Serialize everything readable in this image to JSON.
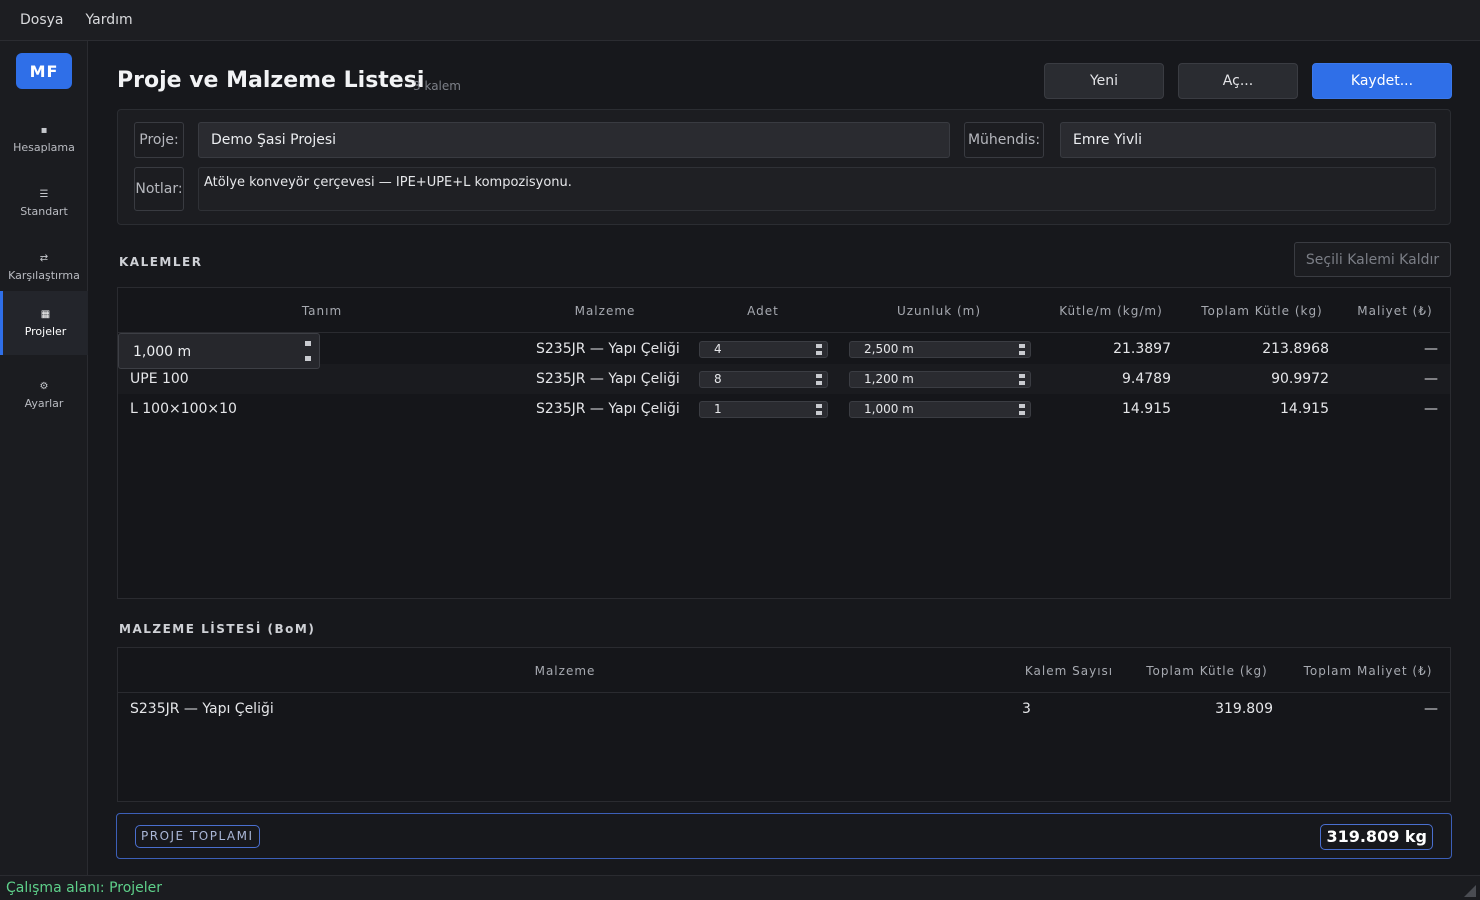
{
  "menu": {
    "file": "Dosya",
    "help": "Yardım"
  },
  "sidebar": {
    "logo": "MF",
    "items": [
      {
        "label": "Hesaplama",
        "icon": "▪"
      },
      {
        "label": "Standart",
        "icon": "☰"
      },
      {
        "label": "Karşılaştırma",
        "icon": "⇄"
      },
      {
        "label": "Projeler",
        "icon": "▦",
        "active": true
      },
      {
        "label": "Ayarlar",
        "icon": "⚙"
      }
    ]
  },
  "header": {
    "title": "Proje ve Malzeme Listesi",
    "count": "3 kalem",
    "new": "Yeni",
    "open": "Aç...",
    "save": "Kaydet..."
  },
  "form": {
    "project_label": "Proje:",
    "project_value": "Demo Şasi Projesi",
    "engineer_label": "Mühendis:",
    "engineer_value": "Emre Yivli",
    "notes_label": "Notlar:",
    "notes_value": "Atölye konveyör çerçevesi — IPE+UPE+L kompozisyonu."
  },
  "items": {
    "section": "KALEMLER",
    "remove_button": "Seçili Kalemi Kaldır",
    "columns": [
      "Tanım",
      "Malzeme",
      "Adet",
      "Uzunluk (m)",
      "Kütle/m (kg/m)",
      "Toplam Kütle (kg)",
      "Maliyet (₺)"
    ],
    "editor_value": "1,000 m",
    "rows": [
      {
        "name": "",
        "material": "S235JR — Yapı Çeliği",
        "qty": "4",
        "length": "2,500 m",
        "mass_per_m": "21.3897",
        "total_mass": "213.8968",
        "cost": "—"
      },
      {
        "name": "UPE 100",
        "material": "S235JR — Yapı Çeliği",
        "qty": "8",
        "length": "1,200 m",
        "mass_per_m": "9.4789",
        "total_mass": "90.9972",
        "cost": "—"
      },
      {
        "name": "L 100×100×10",
        "material": "S235JR — Yapı Çeliği",
        "qty": "1",
        "length": "1,000 m",
        "mass_per_m": "14.915",
        "total_mass": "14.915",
        "cost": "—"
      }
    ]
  },
  "bom": {
    "section": "MALZEME LİSTESİ (BoM)",
    "columns": [
      "Malzeme",
      "Kalem Sayısı",
      "Toplam Kütle (kg)",
      "Toplam Maliyet (₺)"
    ],
    "rows": [
      {
        "material": "S235JR — Yapı Çeliği",
        "count": "3",
        "total_mass": "319.809",
        "total_cost": "—"
      }
    ]
  },
  "total": {
    "label": "PROJE TOPLAMI",
    "value": "319.809 kg"
  },
  "status": "Çalışma alanı: Projeler",
  "colors": {
    "accent": "#2f6fe8",
    "status_text": "#5ed08a",
    "background": "#17181c"
  }
}
